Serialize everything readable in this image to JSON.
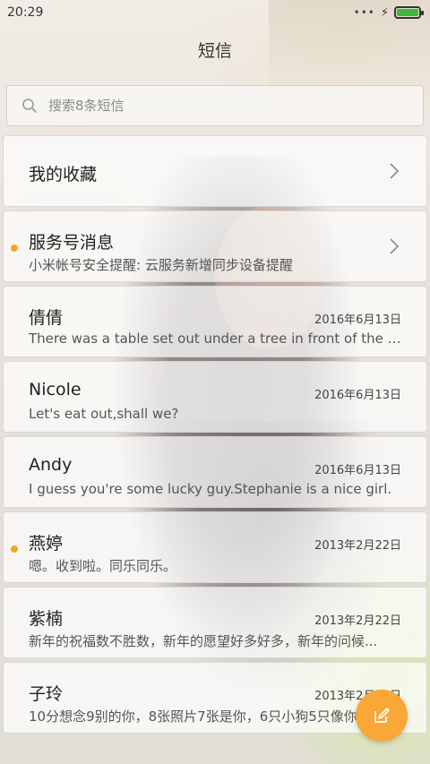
{
  "status_bar": {
    "time": "20:29",
    "signal_icon": "more-dots-icon",
    "charging_icon": "bolt-icon",
    "battery_level": 1.0,
    "battery_color": "#3db93d"
  },
  "header": {
    "title": "短信"
  },
  "search": {
    "placeholder": "搜索8条短信",
    "value": "",
    "icon": "search-icon"
  },
  "conversations": [
    {
      "name": "我的收藏",
      "preview": "",
      "date": "",
      "unread": false,
      "chevron": true
    },
    {
      "name": "服务号消息",
      "preview": "小米帐号安全提醒: 云服务新增同步设备提醒",
      "date": "",
      "unread": true,
      "chevron": true
    },
    {
      "name": "倩倩",
      "preview": "There was a table set out under a tree in front of the ho...",
      "date": "2016年6月13日",
      "unread": false,
      "chevron": false
    },
    {
      "name": "Nicole",
      "preview": "Let's eat out,shall we?",
      "date": "2016年6月13日",
      "unread": false,
      "chevron": false
    },
    {
      "name": "Andy",
      "preview": "I guess you're some lucky guy.Stephanie is a nice girl.",
      "date": "2016年6月13日",
      "unread": false,
      "chevron": false
    },
    {
      "name": "燕婷",
      "preview": "嗯。收到啦。同乐同乐。",
      "date": "2013年2月22日",
      "unread": true,
      "chevron": false
    },
    {
      "name": "紫楠",
      "preview": "新年的祝福数不胜数，新年的愿望好多好多，新年的问候...",
      "date": "2013年2月22日",
      "unread": false,
      "chevron": false
    },
    {
      "name": "子玲",
      "preview": "10分想念9别的你，8张照片7张是你，6只小狗5只像你...",
      "date": "2013年2月22日",
      "unread": false,
      "chevron": false
    }
  ],
  "fab": {
    "icon": "compose-icon",
    "color": "#f9a736"
  },
  "colors": {
    "unread_dot": "#f5a623"
  }
}
